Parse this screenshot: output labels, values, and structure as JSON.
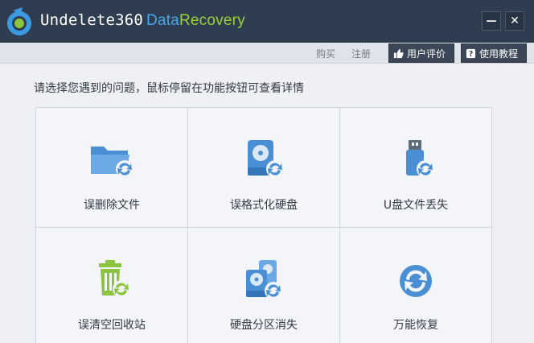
{
  "app": {
    "title_part1": "Undelete360",
    "title_part2": "Data",
    "title_part3": "Recovery",
    "minimize_glyph": "—",
    "close_glyph": "✕"
  },
  "toolbar": {
    "buy_label": "购买",
    "register_label": "注册",
    "rate_label": "用户评价",
    "tutorial_label": "使用教程"
  },
  "main": {
    "prompt": "请选择您遇到的问题，鼠标停留在功能按钮可查看详情",
    "options": [
      {
        "label": "误删除文件",
        "icon": "folder-recover-icon"
      },
      {
        "label": "误格式化硬盘",
        "icon": "harddisk-recover-icon"
      },
      {
        "label": "U盘文件丢失",
        "icon": "usb-recover-icon"
      },
      {
        "label": "误清空回收站",
        "icon": "recycle-bin-recover-icon"
      },
      {
        "label": "硬盘分区消失",
        "icon": "partition-recover-icon"
      },
      {
        "label": "万能恢复",
        "icon": "universal-recover-icon"
      }
    ]
  },
  "colors": {
    "titlebar": "#2e3d4f",
    "accent_blue": "#4a8fd4",
    "accent_green": "#8bc53f"
  }
}
